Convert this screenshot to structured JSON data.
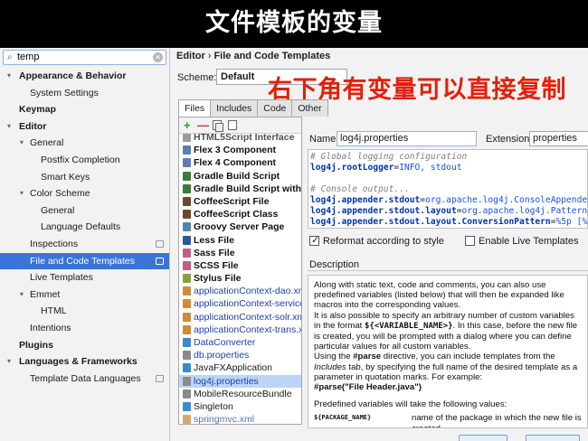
{
  "banner": {
    "title": "文件模板的变量"
  },
  "overlay_note": "右下角有变量可以直接复制",
  "search": {
    "value": "temp"
  },
  "tree": [
    {
      "label": "Appearance & Behavior",
      "level": 0,
      "bold": true,
      "arrow": "▾"
    },
    {
      "label": "System Settings",
      "level": 2,
      "bold": false,
      "arrow": ""
    },
    {
      "label": "Keymap",
      "level": 0,
      "bold": true,
      "arrow": ""
    },
    {
      "label": "Editor",
      "level": 0,
      "bold": true,
      "arrow": "▾"
    },
    {
      "label": "General",
      "level": 1,
      "bold": false,
      "arrow": "▾"
    },
    {
      "label": "Postfix Completion",
      "level": 3,
      "bold": false,
      "arrow": ""
    },
    {
      "label": "Smart Keys",
      "level": 3,
      "bold": false,
      "arrow": ""
    },
    {
      "label": "Color Scheme",
      "level": 1,
      "bold": false,
      "arrow": "▾"
    },
    {
      "label": "General",
      "level": 3,
      "bold": false,
      "arrow": ""
    },
    {
      "label": "Language Defaults",
      "level": 3,
      "bold": false,
      "arrow": ""
    },
    {
      "label": "Inspections",
      "level": 2,
      "bold": false,
      "arrow": "",
      "gico": true
    },
    {
      "label": "File and Code Templates",
      "level": 2,
      "bold": false,
      "arrow": "",
      "gico": true,
      "selected": true
    },
    {
      "label": "Live Templates",
      "level": 2,
      "bold": false,
      "arrow": ""
    },
    {
      "label": "Emmet",
      "level": 1,
      "bold": false,
      "arrow": "▾"
    },
    {
      "label": "HTML",
      "level": 3,
      "bold": false,
      "arrow": ""
    },
    {
      "label": "Intentions",
      "level": 2,
      "bold": false,
      "arrow": ""
    },
    {
      "label": "Plugins",
      "level": 0,
      "bold": true,
      "arrow": ""
    },
    {
      "label": "Languages & Frameworks",
      "level": 0,
      "bold": true,
      "arrow": "▾"
    },
    {
      "label": "Template Data Languages",
      "level": 2,
      "bold": false,
      "arrow": "",
      "gico": true
    }
  ],
  "breadcrumb": {
    "part1": "Editor",
    "sep": "›",
    "part2": "File and Code Templates"
  },
  "scheme": {
    "label": "Scheme:",
    "value": "Default"
  },
  "tabs": [
    {
      "label": "Files",
      "active": true
    },
    {
      "label": "Includes",
      "active": false
    },
    {
      "label": "Code",
      "active": false
    },
    {
      "label": "Other",
      "active": false
    }
  ],
  "templates": [
    {
      "name": "HTML5Script Interface",
      "style": "b",
      "icon": "#7a7a7a",
      "cut": true
    },
    {
      "name": "Flex 3 Component",
      "style": "b",
      "icon": "#5b7fb5"
    },
    {
      "name": "Flex 4 Component",
      "style": "b",
      "icon": "#5b7fb5"
    },
    {
      "name": "Gradle Build Script",
      "style": "b",
      "icon": "#3a7a3a"
    },
    {
      "name": "Gradle Build Script with wr",
      "style": "b",
      "icon": "#3a7a3a"
    },
    {
      "name": "CoffeeScript File",
      "style": "b",
      "icon": "#6b4a2a"
    },
    {
      "name": "CoffeeScript Class",
      "style": "b",
      "icon": "#6b4a2a"
    },
    {
      "name": "Groovy Server Page",
      "style": "b",
      "icon": "#4a8ab0"
    },
    {
      "name": "Less File",
      "style": "b",
      "icon": "#2a5a9a"
    },
    {
      "name": "Sass File",
      "style": "b",
      "icon": "#c45a8a"
    },
    {
      "name": "SCSS File",
      "style": "b",
      "icon": "#c45a8a"
    },
    {
      "name": "Stylus File",
      "style": "b",
      "icon": "#8aa040"
    },
    {
      "name": "applicationContext-dao.xml",
      "style": "x",
      "icon": "#d08a3a"
    },
    {
      "name": "applicationContext-service.xm",
      "style": "x",
      "icon": "#d08a3a"
    },
    {
      "name": "applicationContext-solr.xml",
      "style": "x",
      "icon": "#d08a3a"
    },
    {
      "name": "applicationContext-trans.xml",
      "style": "x",
      "icon": "#d08a3a"
    },
    {
      "name": "DataConverter",
      "style": "x",
      "icon": "#3a8ad0"
    },
    {
      "name": "db.properties",
      "style": "x",
      "icon": "#8a8a8a"
    },
    {
      "name": "JavaFXApplication",
      "style": "n",
      "icon": "#3a8ad0"
    },
    {
      "name": "log4j.properties",
      "style": "x",
      "icon": "#8a8a8a",
      "selected": true
    },
    {
      "name": "MobileResourceBundle",
      "style": "n",
      "icon": "#8a8a8a"
    },
    {
      "name": "Singleton",
      "style": "n",
      "icon": "#3a8ad0"
    },
    {
      "name": "springmvc.xml",
      "style": "x",
      "icon": "#d08a3a",
      "cut": true
    }
  ],
  "name_field": {
    "label": "Name:",
    "value": "log4j.properties"
  },
  "ext_field": {
    "label": "Extension:",
    "value": "properties"
  },
  "code_lines": [
    [
      {
        "t": "# Global logging configuration",
        "c": "cm"
      }
    ],
    [
      {
        "t": "log4j.rootLogger",
        "c": "ck"
      },
      {
        "t": "=",
        "c": "cp"
      },
      {
        "t": "INFO, stdout",
        "c": "cv"
      }
    ],
    [
      {
        "t": "",
        "c": "cp"
      }
    ],
    [
      {
        "t": "# Console output...",
        "c": "cm"
      }
    ],
    [
      {
        "t": "log4j.appender.stdout",
        "c": "ck"
      },
      {
        "t": "=",
        "c": "cp"
      },
      {
        "t": "org.apache.log4j.ConsoleAppender",
        "c": "cv"
      }
    ],
    [
      {
        "t": "log4j.appender.stdout.layout",
        "c": "ck"
      },
      {
        "t": "=",
        "c": "cp"
      },
      {
        "t": "org.apache.log4j.PatternLayout",
        "c": "cv"
      }
    ],
    [
      {
        "t": "log4j.appender.stdout.layout.ConversionPattern",
        "c": "ck"
      },
      {
        "t": "=",
        "c": "cp"
      },
      {
        "t": "%5p [%t] - %",
        "c": "cv"
      }
    ]
  ],
  "checkboxes": {
    "reformat": {
      "label": "Reformat according to style",
      "checked": true
    },
    "live": {
      "label": "Enable Live Templates",
      "checked": false
    }
  },
  "description": {
    "label": "Description",
    "p1": "Along with static text, code and comments, you can also use predefined variables (listed below) that will then be expanded like macros into the corresponding values.",
    "p2_pre": "It is also possible to specify an arbitrary number of custom variables in the format ",
    "p2_code": "${<VARIABLE_NAME>}",
    "p2_post": ". In this case, before the new file is created, you will be prompted with a dialog where you can define particular values for all custom variables.",
    "p3_a": "Using the ",
    "p3_b": "#parse",
    "p3_c": " directive, you can include templates from the ",
    "p3_d": "Includes",
    "p3_e": " tab, by specifying the full name of the desired template as a parameter in quotation marks. For example:",
    "p3_example": "#parse(\"File Header.java\")",
    "p4": "Predefined variables will take the following values:",
    "var_name": "${PACKAGE_NAME}",
    "var_desc": "name of the package in which the new file is created"
  }
}
